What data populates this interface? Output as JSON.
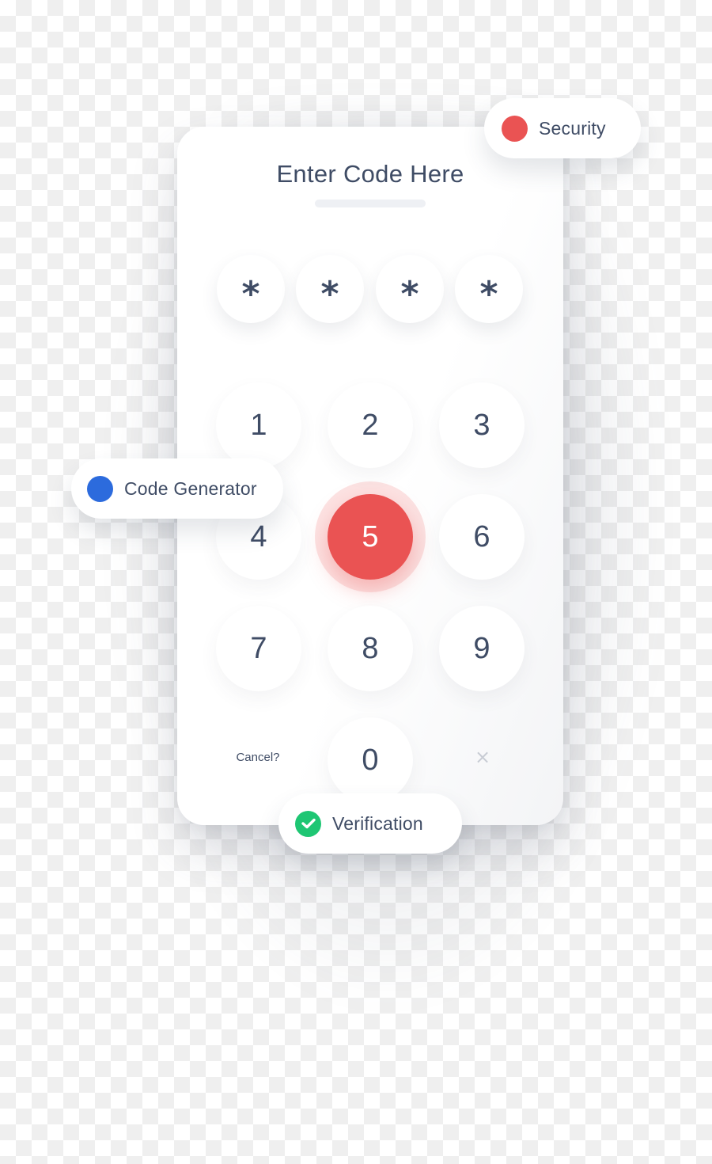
{
  "header": {
    "title": "Enter Code Here"
  },
  "pin": {
    "mask_char": "*",
    "slots": [
      "*",
      "*",
      "*",
      "*"
    ]
  },
  "keypad": {
    "keys": [
      "1",
      "2",
      "3",
      "4",
      "5",
      "6",
      "7",
      "8",
      "9",
      "0"
    ],
    "active_key": "5",
    "cancel_label": "Cancel?",
    "clear_label": "×"
  },
  "badges": {
    "security": {
      "label": "Security",
      "icon": "red-dot-icon",
      "color": "#ea5353"
    },
    "code_generator": {
      "label": "Code Generator",
      "icon": "blue-dot-icon",
      "color": "#2c6bdd"
    },
    "verification": {
      "label": "Verification",
      "icon": "check-circle-icon",
      "color": "#1ec673"
    }
  },
  "colors": {
    "text": "#3f4c65",
    "accent": "#ea5353"
  }
}
